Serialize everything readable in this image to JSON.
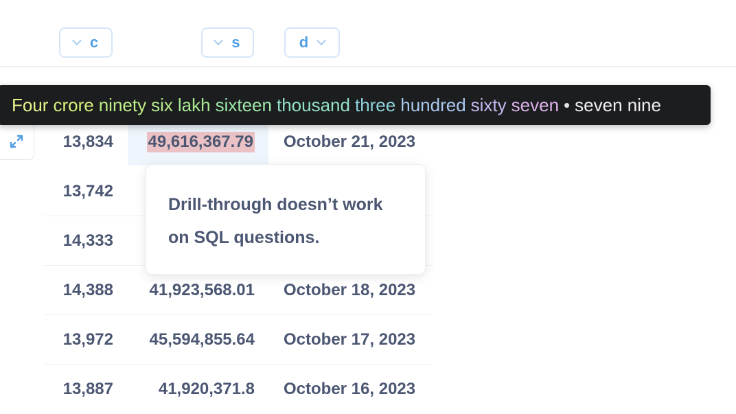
{
  "columns": [
    {
      "label": "c"
    },
    {
      "label": "s"
    },
    {
      "label": "d"
    }
  ],
  "rows": [
    {
      "c": "13,834",
      "s": "49,616,367.79",
      "d": "October 21, 2023"
    },
    {
      "c": "13,742",
      "s": "",
      "d": ""
    },
    {
      "c": "14,333",
      "s": "",
      "d": ""
    },
    {
      "c": "14,388",
      "s": "41,923,568.01",
      "d": "October 18, 2023"
    },
    {
      "c": "13,972",
      "s": "45,594,855.64",
      "d": "October 17, 2023"
    },
    {
      "c": "13,887",
      "s": "41,920,371.8",
      "d": "October 16, 2023"
    }
  ],
  "tooltip": {
    "words": [
      "Four",
      "crore",
      "ninety",
      "six",
      "lakh",
      "sixteen",
      "thousand",
      "three",
      "hundred",
      "sixty",
      "seven"
    ],
    "colors": [
      "#e9f58a",
      "#d5f27a",
      "#c0ee86",
      "#b4ec8c",
      "#a7ea92",
      "#9ee8a8",
      "#93e0c6",
      "#8ed4dc",
      "#a8c8ee",
      "#c2b8ee",
      "#dcb3ec"
    ],
    "separator": "•",
    "suffix": "seven nine"
  },
  "popover": {
    "message": "Drill-through doesn’t work on SQL questions."
  },
  "icons": {
    "expand": "expand-icon"
  },
  "colors": {
    "accent": "#509ee3",
    "highlight": "#eac1c4",
    "text": "#4c5773"
  }
}
